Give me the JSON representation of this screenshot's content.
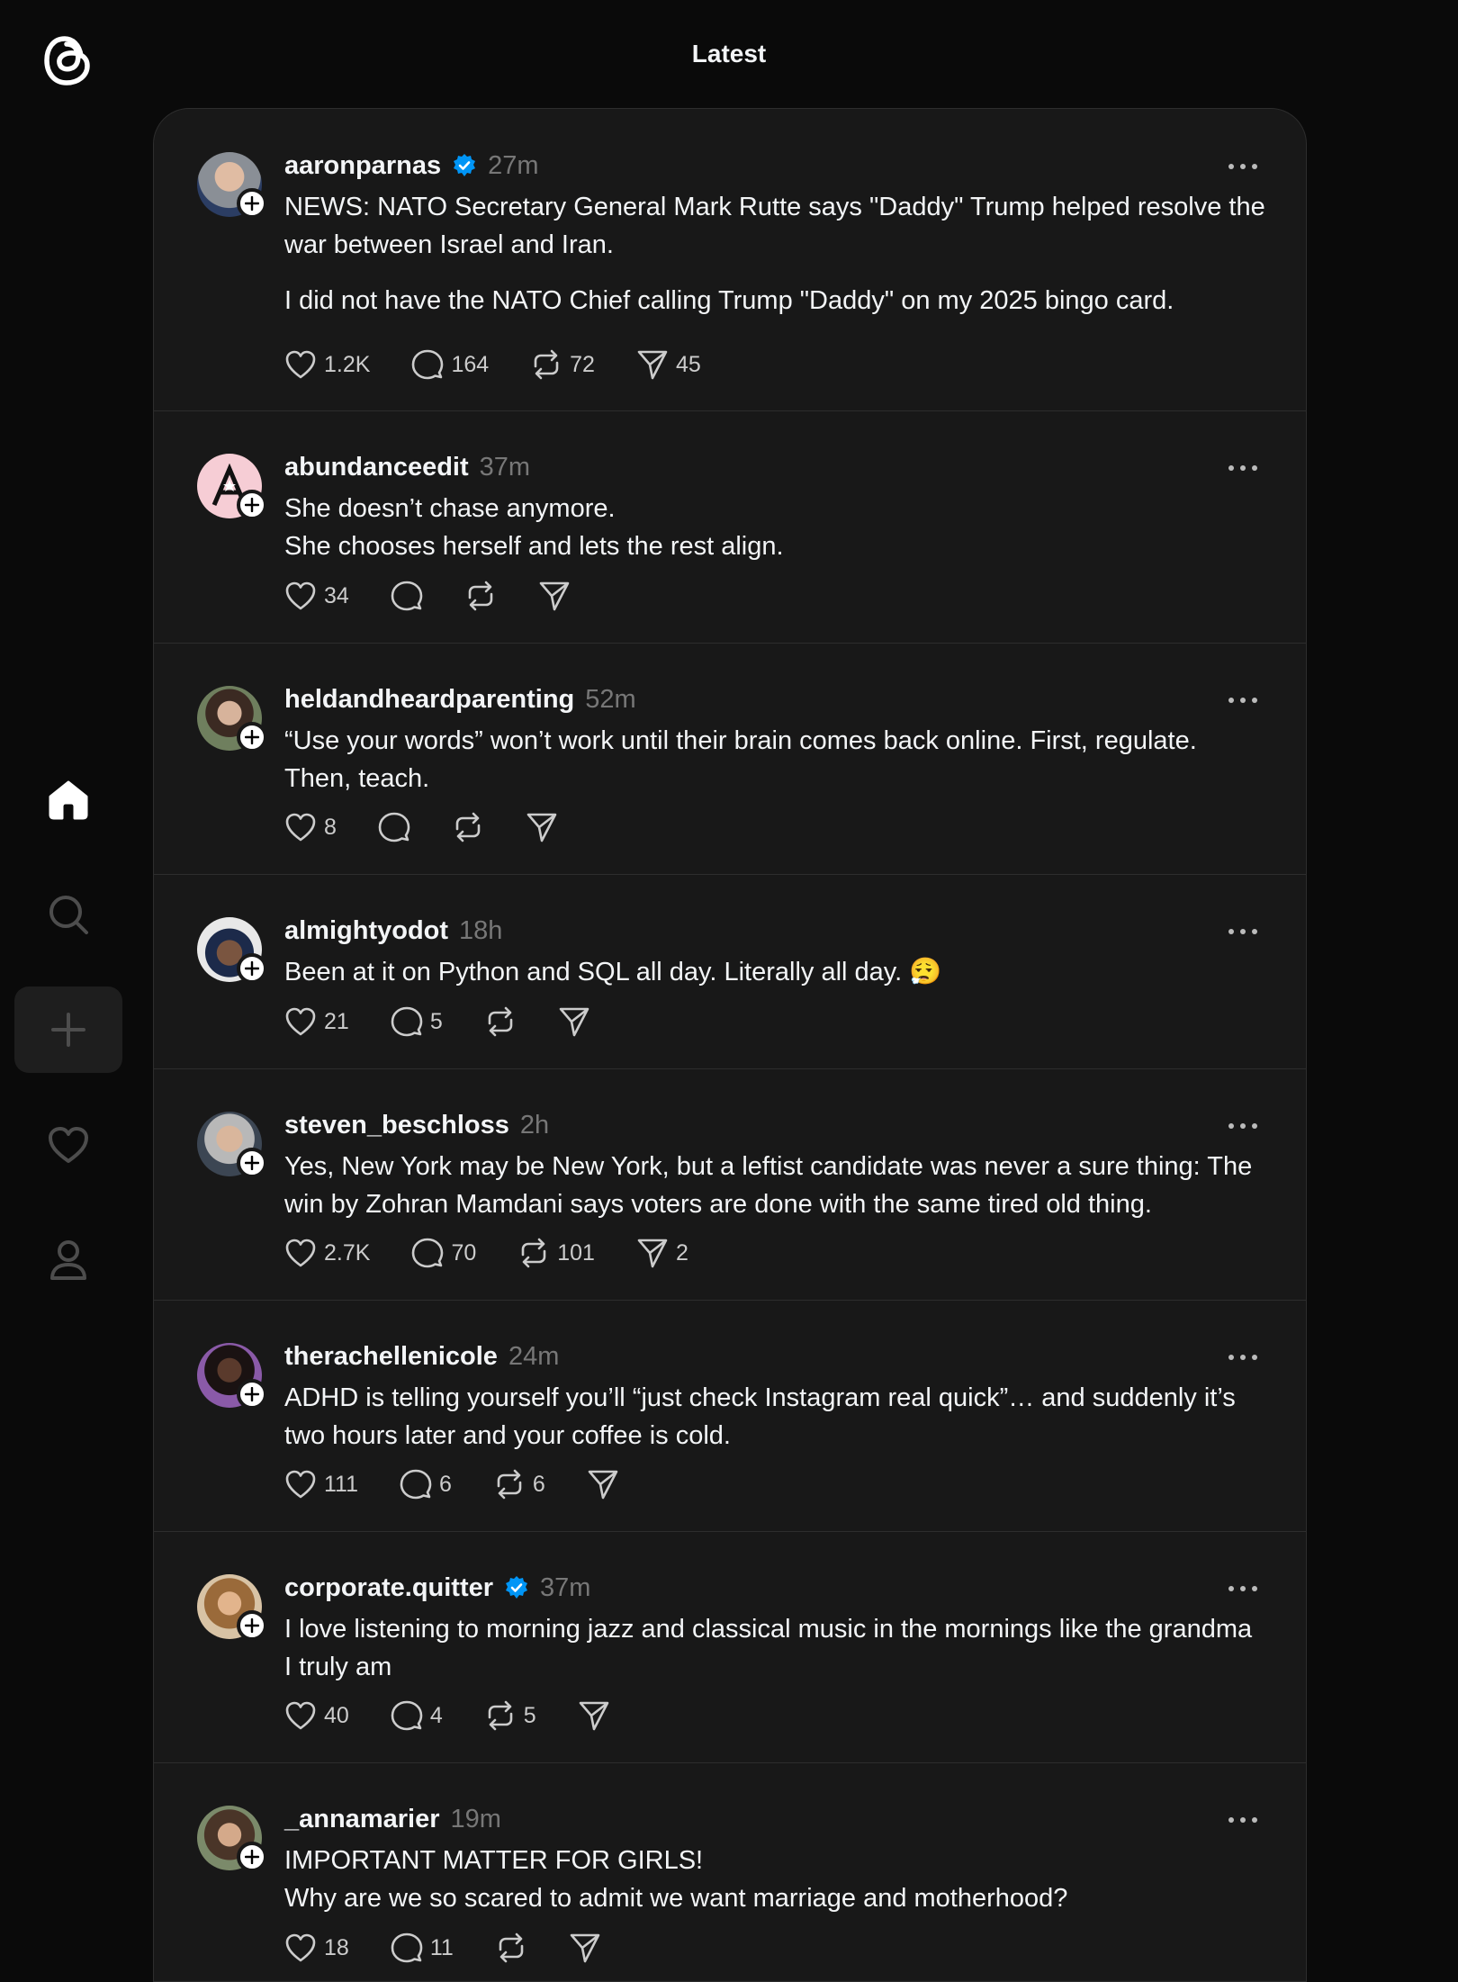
{
  "page_title": "Latest",
  "sidebar": {
    "logo": "threads-logo-icon",
    "items": [
      {
        "name": "home",
        "icon": "home-icon",
        "active": true
      },
      {
        "name": "search",
        "icon": "search-icon"
      },
      {
        "name": "create",
        "icon": "plus-icon"
      },
      {
        "name": "activity",
        "icon": "heart-icon"
      },
      {
        "name": "profile",
        "icon": "person-icon"
      }
    ]
  },
  "posts": [
    {
      "username": "aaronparnas",
      "verified": true,
      "time": "27m",
      "paragraphs": [
        "NEWS: NATO Secretary General Mark Rutte says \"Daddy\" Trump helped resolve the war between Israel and Iran.",
        "I did not have the NATO Chief calling Trump \"Daddy\" on my 2025 bingo card."
      ],
      "likes": "1.2K",
      "replies": "164",
      "reposts": "72",
      "shares": "45"
    },
    {
      "username": "abundanceedit",
      "verified": false,
      "time": "37m",
      "paragraphs": [
        "She doesn’t chase anymore.",
        "She chooses herself and lets the rest align."
      ],
      "likes": "34",
      "replies": "",
      "reposts": "",
      "shares": ""
    },
    {
      "username": "heldandheardparenting",
      "verified": false,
      "time": "52m",
      "paragraphs": [
        "“Use your words” won’t work until their brain comes back online. First, regulate. Then, teach."
      ],
      "likes": "8",
      "replies": "",
      "reposts": "",
      "shares": ""
    },
    {
      "username": "almightyodot",
      "verified": false,
      "time": "18h",
      "paragraphs": [
        "Been at it on Python and SQL all day. Literally all day. 😮‍💨"
      ],
      "likes": "21",
      "replies": "5",
      "reposts": "",
      "shares": ""
    },
    {
      "username": "steven_beschloss",
      "verified": false,
      "time": "2h",
      "paragraphs": [
        "Yes, New York may be New York, but a leftist candidate was never a sure thing: The win by Zohran Mamdani says voters are done with the same tired old thing."
      ],
      "likes": "2.7K",
      "replies": "70",
      "reposts": "101",
      "shares": "2"
    },
    {
      "username": "therachellenicole",
      "verified": false,
      "time": "24m",
      "paragraphs": [
        "ADHD is telling yourself you’ll “just check Instagram real quick”… and suddenly it’s two hours later and your coffee is cold."
      ],
      "likes": "111",
      "replies": "6",
      "reposts": "6",
      "shares": ""
    },
    {
      "username": "corporate.quitter",
      "verified": true,
      "time": "37m",
      "paragraphs": [
        "I love listening to morning jazz and classical music in the mornings like the grandma I truly am"
      ],
      "likes": "40",
      "replies": "4",
      "reposts": "5",
      "shares": ""
    },
    {
      "username": "_annamarier",
      "verified": false,
      "time": "19m",
      "paragraphs": [
        "IMPORTANT MATTER FOR GIRLS!",
        "Why are we so scared to admit we want marriage and motherhood?"
      ],
      "likes": "18",
      "replies": "11",
      "reposts": "",
      "shares": ""
    }
  ],
  "colors": {
    "background": "#0a0a0a",
    "card": "#181818",
    "divider": "#2d2d2d",
    "text": "#f3f5f7",
    "muted": "#777777",
    "verified": "#0095f6"
  }
}
